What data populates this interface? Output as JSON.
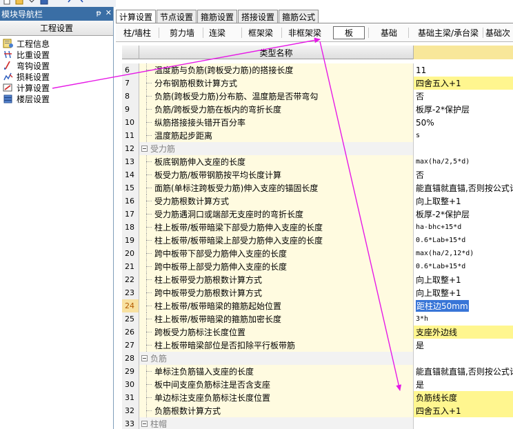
{
  "nav": {
    "header_title": "模块导航栏",
    "pin_glyph": "ᵽ",
    "close_glyph": "✕",
    "group_title": "工程设置",
    "items": [
      {
        "label": "工程信息",
        "icon": "project-info-icon"
      },
      {
        "label": "比重设置",
        "icon": "weight-setting-icon"
      },
      {
        "label": "弯钩设置",
        "icon": "hook-setting-icon"
      },
      {
        "label": "损耗设置",
        "icon": "loss-setting-icon"
      },
      {
        "label": "计算设置",
        "icon": "calc-setting-icon"
      },
      {
        "label": "楼层设置",
        "icon": "floor-setting-icon"
      }
    ]
  },
  "tabs": [
    {
      "label": "计算设置",
      "active": true
    },
    {
      "label": "节点设置",
      "active": false
    },
    {
      "label": "箍筋设置",
      "active": false
    },
    {
      "label": "搭接设置",
      "active": false
    },
    {
      "label": "箍筋公式",
      "active": false
    }
  ],
  "subtabs": [
    {
      "label": "柱/墙柱",
      "active": false
    },
    {
      "label": "剪力墙",
      "active": false
    },
    {
      "label": "连梁",
      "active": false
    },
    {
      "label": "框架梁",
      "active": false
    },
    {
      "label": "非框架梁",
      "active": false
    },
    {
      "label": "板",
      "active": true
    },
    {
      "label": "基础",
      "active": false
    },
    {
      "label": "基础主梁/承台梁",
      "active": false
    },
    {
      "label": "基础次",
      "active": false
    }
  ],
  "grid": {
    "header_name": "类型名称",
    "rows": [
      {
        "num": "6",
        "name": "温度筋与负筋(跨板受力筋)的搭接长度",
        "value": "11",
        "style": "plain"
      },
      {
        "num": "7",
        "name": "分布钢筋根数计算方式",
        "value": "四舍五入+1",
        "style": "yellow"
      },
      {
        "num": "8",
        "name": "负筋(跨板受力筋)分布筋、温度筋是否带弯勾",
        "value": "否",
        "style": "plain"
      },
      {
        "num": "9",
        "name": "负筋/跨板受力筋在板内的弯折长度",
        "value": "板厚-2*保护层",
        "style": "plain"
      },
      {
        "num": "10",
        "name": "纵筋搭接接头错开百分率",
        "value": "50%",
        "style": "plain"
      },
      {
        "num": "11",
        "name": "温度筋起步距离",
        "value": "s",
        "style": "mono"
      },
      {
        "num": "12",
        "name": "受力筋",
        "value": "",
        "style": "group"
      },
      {
        "num": "13",
        "name": "板底钢筋伸入支座的长度",
        "value": "max(ha/2,5*d)",
        "style": "mono"
      },
      {
        "num": "14",
        "name": "板受力筋/板带钢筋按平均长度计算",
        "value": "否",
        "style": "plain"
      },
      {
        "num": "15",
        "name": "面筋(单标注跨板受力筋)伸入支座的锚固长度",
        "value": "能直锚就直锚,否则按公式计",
        "style": "plain"
      },
      {
        "num": "16",
        "name": "受力筋根数计算方式",
        "value": "向上取整+1",
        "style": "plain"
      },
      {
        "num": "17",
        "name": "受力筋遇洞口或端部无支座时的弯折长度",
        "value": "板厚-2*保护层",
        "style": "plain"
      },
      {
        "num": "18",
        "name": "柱上板带/板带暗梁下部受力筋伸入支座的长度",
        "value": "ha-bhc+15*d",
        "style": "mono"
      },
      {
        "num": "19",
        "name": "柱上板带/板带暗梁上部受力筋伸入支座的长度",
        "value": "0.6*Lab+15*d",
        "style": "mono"
      },
      {
        "num": "20",
        "name": "跨中板带下部受力筋伸入支座的长度",
        "value": "max(ha/2,12*d)",
        "style": "mono"
      },
      {
        "num": "21",
        "name": "跨中板带上部受力筋伸入支座的长度",
        "value": "0.6*Lab+15*d",
        "style": "mono"
      },
      {
        "num": "22",
        "name": "柱上板带受力筋根数计算方式",
        "value": "向上取整+1",
        "style": "plain"
      },
      {
        "num": "23",
        "name": "跨中板带受力筋根数计算方式",
        "value": "向上取整+1",
        "style": "plain"
      },
      {
        "num": "24",
        "name": "柱上板带/板带暗梁的箍筋起始位置",
        "value": "距柱边50mm",
        "style": "selected"
      },
      {
        "num": "25",
        "name": "柱上板带/板带暗梁的箍筋加密长度",
        "value": "3*h",
        "style": "mono"
      },
      {
        "num": "26",
        "name": "跨板受力筋标注长度位置",
        "value": "支座外边线",
        "style": "yellow"
      },
      {
        "num": "27",
        "name": "柱上板带暗梁部位是否扣除平行板带筋",
        "value": "是",
        "style": "plain"
      },
      {
        "num": "28",
        "name": "负筋",
        "value": "",
        "style": "group"
      },
      {
        "num": "29",
        "name": "单标注负筋锚入支座的长度",
        "value": "能直锚就直锚,否则按公式计",
        "style": "plain"
      },
      {
        "num": "30",
        "name": "板中间支座负筋标注是否含支座",
        "value": "是",
        "style": "plain"
      },
      {
        "num": "31",
        "name": "单边标注支座负筋标注长度位置",
        "value": "负筋线长度",
        "style": "yellow"
      },
      {
        "num": "32",
        "name": "负筋根数计算方式",
        "value": "四舍五入+1",
        "style": "yellow"
      },
      {
        "num": "33",
        "name": "柱帽",
        "value": "",
        "style": "group"
      }
    ]
  },
  "colors": {
    "annotation_arrow": "#e619e6",
    "nav_header_bg": "#3a6ea5",
    "cell_yellow": "#fff68f",
    "name_bg": "#fffbe0"
  }
}
